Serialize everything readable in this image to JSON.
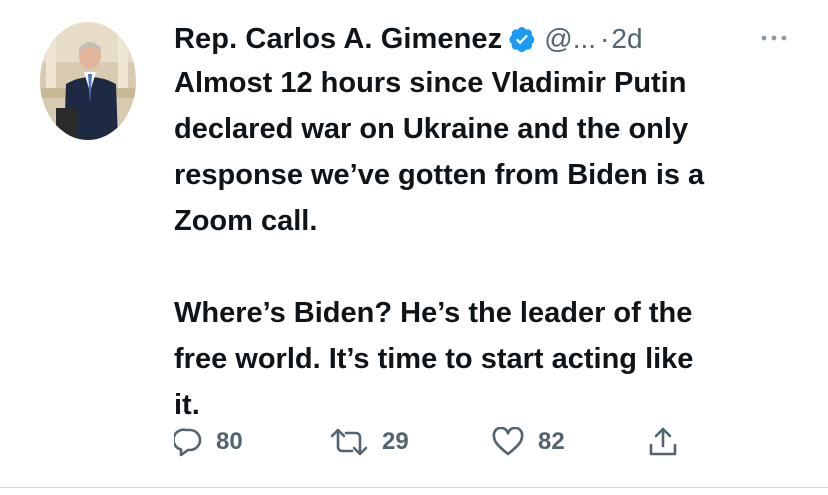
{
  "author": {
    "name": "Rep. Carlos A. Gimenez",
    "handle": "@...",
    "separator": "·",
    "time": "2d",
    "verified": true
  },
  "tweet": {
    "text": "Almost 12 hours since Vladimir Putin\ndeclared war on Ukraine and the only\nresponse we’ve gotten from Biden is a\nZoom call.\n\nWhere’s Biden? He’s the leader of the\nfree world. It’s time to start acting like\nit."
  },
  "actions": {
    "reply_count": "80",
    "retweet_count": "29",
    "like_count": "82"
  },
  "icons": {
    "verified": "verified-badge-icon",
    "more": "more-options-icon",
    "reply": "reply-icon",
    "retweet": "retweet-icon",
    "like": "heart-icon",
    "share": "share-icon"
  },
  "colors": {
    "text": "#0f1419",
    "secondary": "#536471",
    "verified": "#1d9bf0",
    "divider": "#cfd9de"
  }
}
